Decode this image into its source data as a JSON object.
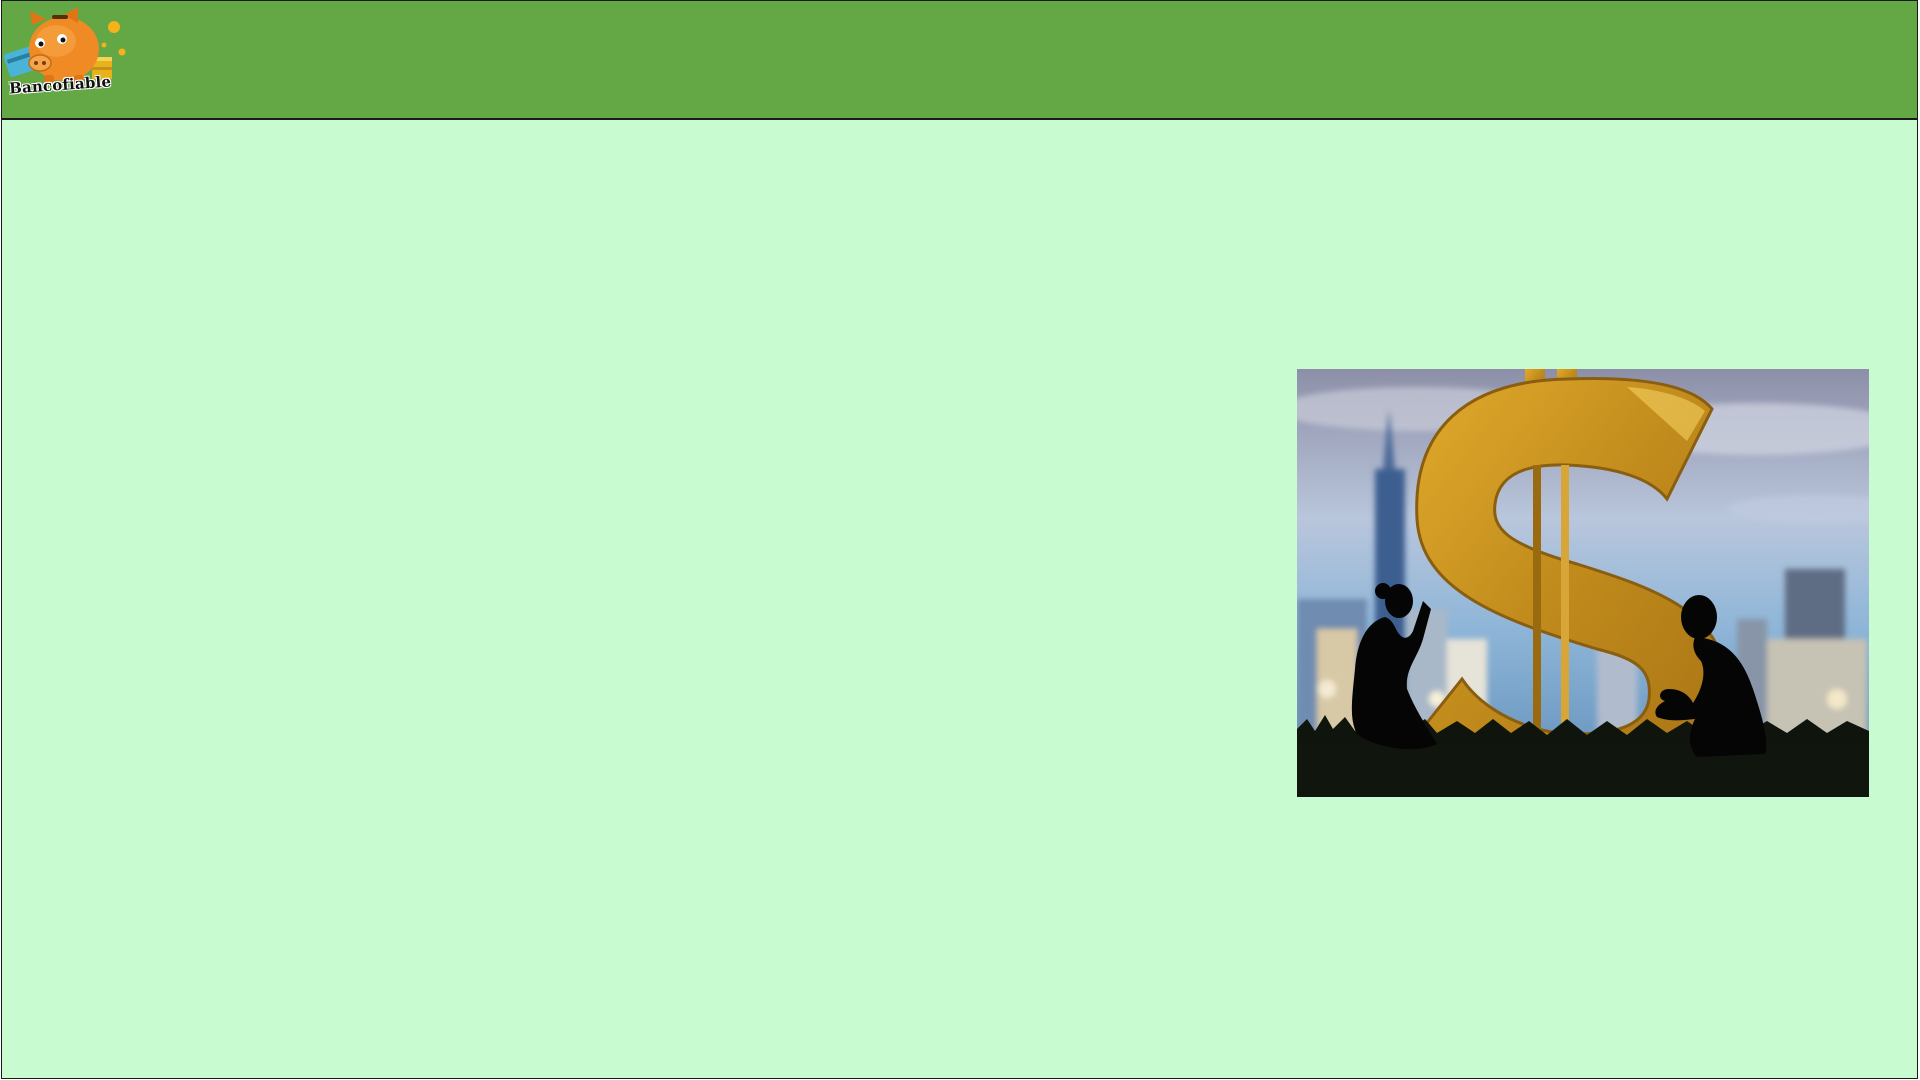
{
  "brand": {
    "name": "Bancofiable",
    "logo_icon": "piggy-bank-icon"
  },
  "hero_image": {
    "icon": "dollar-sign-icon"
  },
  "colors": {
    "header_bg": "#63a845",
    "page_bg": "#c8fcd0",
    "gold": "#c8941e",
    "piggy": "#f08a24"
  }
}
